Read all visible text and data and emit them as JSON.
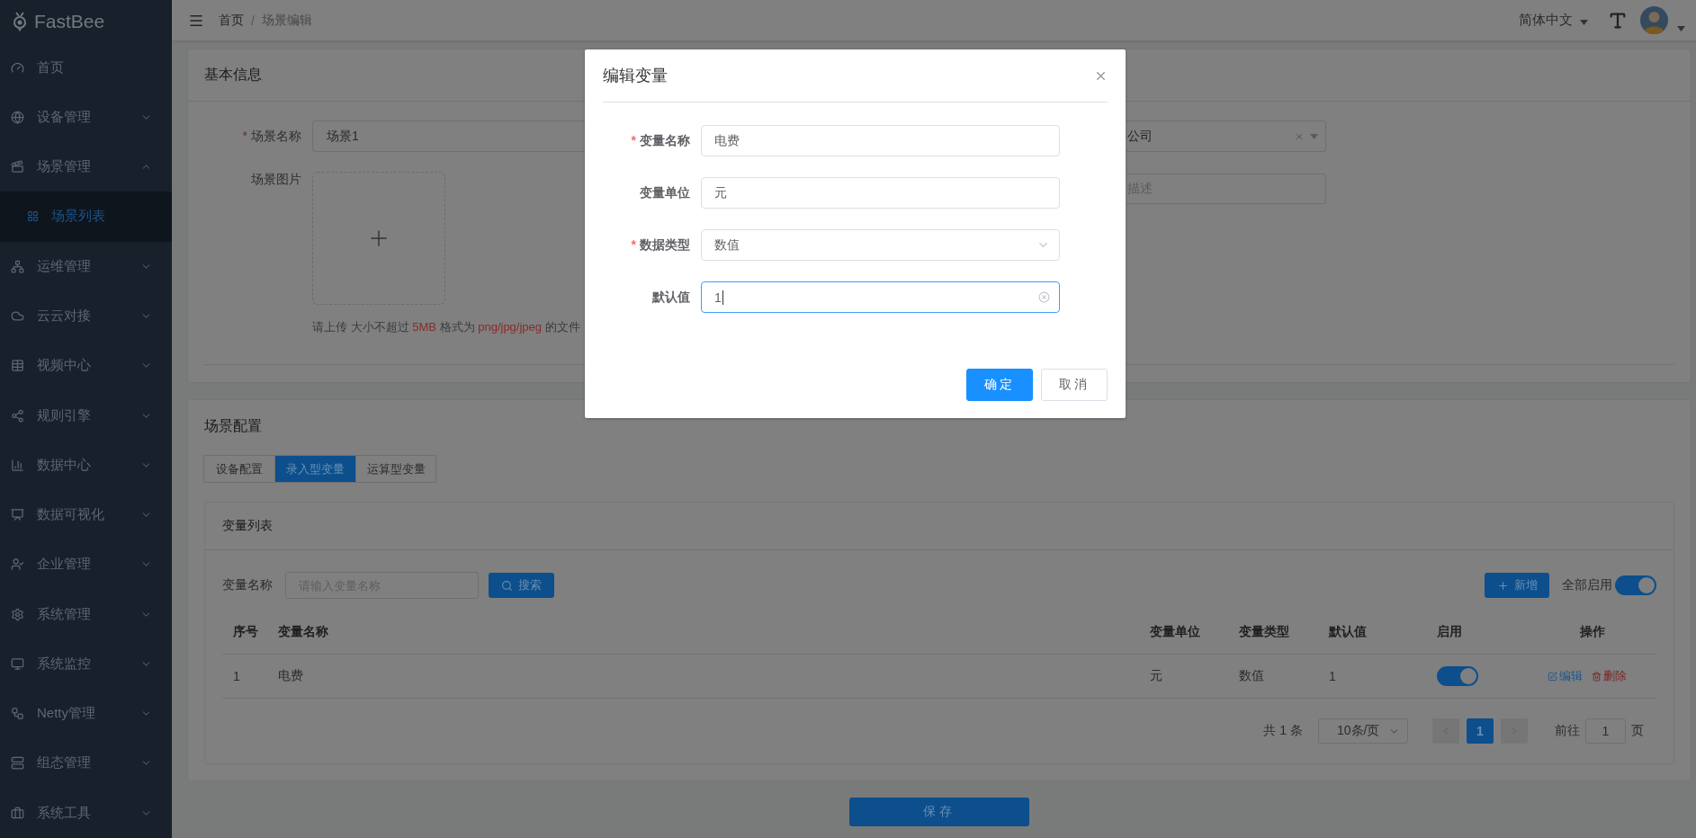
{
  "app": {
    "logo": "FastBee"
  },
  "sidebar": {
    "items": [
      {
        "label": "首页",
        "kind": "link"
      },
      {
        "label": "设备管理",
        "kind": "menu",
        "expanded": false
      },
      {
        "label": "场景管理",
        "kind": "menu",
        "expanded": true,
        "children": [
          {
            "label": "场景列表",
            "selected": true
          }
        ]
      },
      {
        "label": "运维管理",
        "kind": "menu",
        "expanded": false
      },
      {
        "label": "云云对接",
        "kind": "menu",
        "expanded": false
      },
      {
        "label": "视频中心",
        "kind": "menu",
        "expanded": false
      },
      {
        "label": "规则引擎",
        "kind": "menu",
        "expanded": false
      },
      {
        "label": "数据中心",
        "kind": "menu",
        "expanded": false
      },
      {
        "label": "数据可视化",
        "kind": "menu",
        "expanded": false
      },
      {
        "label": "企业管理",
        "kind": "menu",
        "expanded": false
      },
      {
        "label": "系统管理",
        "kind": "menu",
        "expanded": false
      },
      {
        "label": "系统监控",
        "kind": "menu",
        "expanded": false
      },
      {
        "label": "Netty管理",
        "kind": "menu",
        "expanded": false
      },
      {
        "label": "组态管理",
        "kind": "menu",
        "expanded": false
      },
      {
        "label": "系统工具",
        "kind": "menu",
        "expanded": false
      }
    ]
  },
  "header": {
    "breadcrumb": [
      {
        "label": "首页"
      },
      {
        "label": "场景编辑"
      }
    ],
    "separator": "/",
    "language": "简体中文"
  },
  "required_mark": "*",
  "basic_info": {
    "title": "基本信息",
    "name_field": {
      "label": "场景名称",
      "required": true,
      "value": "场景1"
    },
    "image_field": {
      "label": "场景图片"
    },
    "upload_hint": [
      {
        "text": "请上传 大小不超过 ",
        "highlight": false
      },
      {
        "text": "5MB",
        "highlight": true
      },
      {
        "text": " 格式为 ",
        "highlight": false
      },
      {
        "text": "png/jpg/jpeg",
        "highlight": true
      },
      {
        "text": " 的文件",
        "highlight": false
      }
    ],
    "company_select": {
      "value": "公司"
    },
    "description_field": {
      "placeholder": "描述"
    }
  },
  "scene_config": {
    "title": "场景配置",
    "tabs": [
      {
        "label": "设备配置",
        "selected": false
      },
      {
        "label": "录入型变量",
        "selected": true
      },
      {
        "label": "运算型变量",
        "selected": false
      }
    ],
    "variable_list": {
      "title": "变量列表",
      "search": {
        "label": "变量名称",
        "placeholder": "请输入变量名称"
      },
      "search_button": "搜索",
      "add_button": "新增",
      "enable_all": {
        "label": "全部启用",
        "on": true
      },
      "columns": [
        "序号",
        "变量名称",
        "变量单位",
        "变量类型",
        "默认值",
        "启用",
        "操作"
      ],
      "rows": [
        {
          "cells": [
            "1",
            "电费",
            "元",
            "数值",
            "1"
          ],
          "enabled": true,
          "actions": [
            "编辑",
            "删除"
          ]
        }
      ],
      "pagination": {
        "total": "共 1 条",
        "page_size": "10条/页",
        "pages": [
          {
            "label": "1",
            "selected": true
          }
        ],
        "goto_label": "前往",
        "goto_value": "1",
        "goto_suffix": "页"
      }
    }
  },
  "save_button": "保存",
  "dialog": {
    "title": "编辑变量",
    "fields": [
      {
        "kind": "input",
        "label": "变量名称",
        "required": true,
        "value": "电费",
        "focused": false
      },
      {
        "kind": "input",
        "label": "变量单位",
        "required": false,
        "value": "元",
        "focused": false
      },
      {
        "kind": "select",
        "label": "数据类型",
        "required": true,
        "value": "数值",
        "focused": false
      },
      {
        "kind": "input",
        "label": "默认值",
        "required": false,
        "value": "1",
        "focused": true
      }
    ],
    "confirm_button": "确定",
    "cancel_button": "取消"
  }
}
